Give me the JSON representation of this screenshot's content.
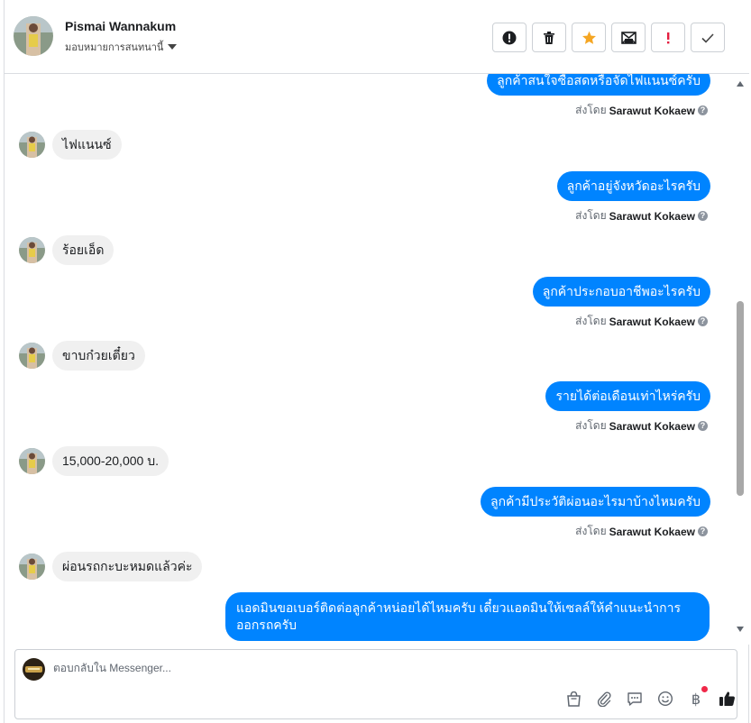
{
  "header": {
    "contact_name": "Pismai Wannakum",
    "assign_label": "มอบหมายการสนทนานี้",
    "actions": [
      {
        "icon": "exclamation-circle-icon"
      },
      {
        "icon": "trash-icon"
      },
      {
        "icon": "star-icon",
        "color": "#f5a623"
      },
      {
        "icon": "mark-unread-icon"
      },
      {
        "icon": "spam-exclamation-icon",
        "color": "#e41e3f"
      },
      {
        "icon": "check-icon"
      }
    ]
  },
  "messages": {
    "sent_by_label": "ส่งโดย",
    "agent_name": "Sarawut Kokaew",
    "out_1": "ลูกค้าสนใจซื้อสดหรือจัดไฟแนนซ์ครับ",
    "in_1": "ไฟแนนซ์",
    "out_2": "ลูกค้าอยู่จังหวัดอะไรครับ",
    "in_2": "ร้อยเอ็ด",
    "out_3": "ลูกค้าประกอบอาชีพอะไรครับ",
    "in_3": "ขาบก๋วยเตี๋ยว",
    "out_4": "รายได้ต่อเดือนเท่าไหร่ครับ",
    "in_4": "15,000-20,000 บ.",
    "out_5": "ลูกค้ามีประวัติผ่อนอะไรมาบ้างไหมครับ",
    "in_5": "ผ่อนรถกะบะหมดแล้วค่ะ",
    "out_6": "แอดมินขอเบอร์ติดต่อลูกค้าหน่อยได้ไหมครับ เดี๋ยวแอดมินให้เซลล์ให้คำแนะนำการออกรถครับ"
  },
  "composer": {
    "placeholder": "ตอบกลับใน Messenger...",
    "currency_symbol": "฿",
    "tools": [
      "shop-bag-icon",
      "paperclip-icon",
      "saved-reply-icon",
      "emoji-icon",
      "baht-payment-icon",
      "thumbs-up-icon"
    ]
  },
  "colors": {
    "accent": "#0084ff",
    "incoming_bubble": "#f0f0f0",
    "star": "#f5a623",
    "danger": "#e41e3f"
  }
}
